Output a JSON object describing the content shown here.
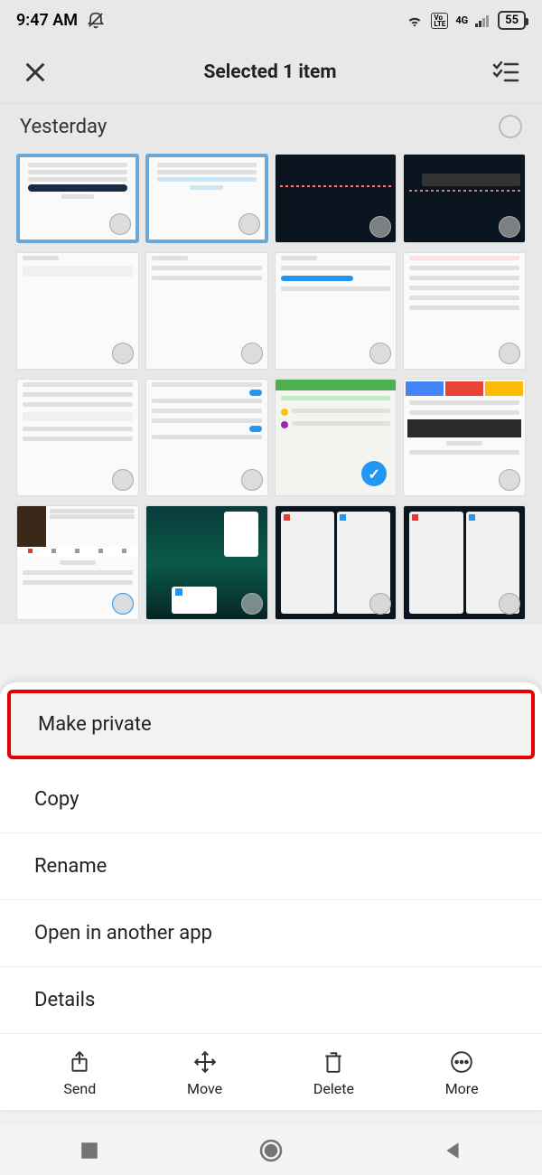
{
  "statusbar": {
    "time": "9:47 AM",
    "battery": "55",
    "signal": "4G"
  },
  "header": {
    "title": "Selected 1 item"
  },
  "section": {
    "title": "Yesterday"
  },
  "menu": {
    "make_private": "Make private",
    "copy": "Copy",
    "rename": "Rename",
    "open_in": "Open in another app",
    "details": "Details"
  },
  "actions": {
    "send": "Send",
    "move": "Move",
    "delete": "Delete",
    "more": "More"
  },
  "vo": "Vo\nLTE"
}
